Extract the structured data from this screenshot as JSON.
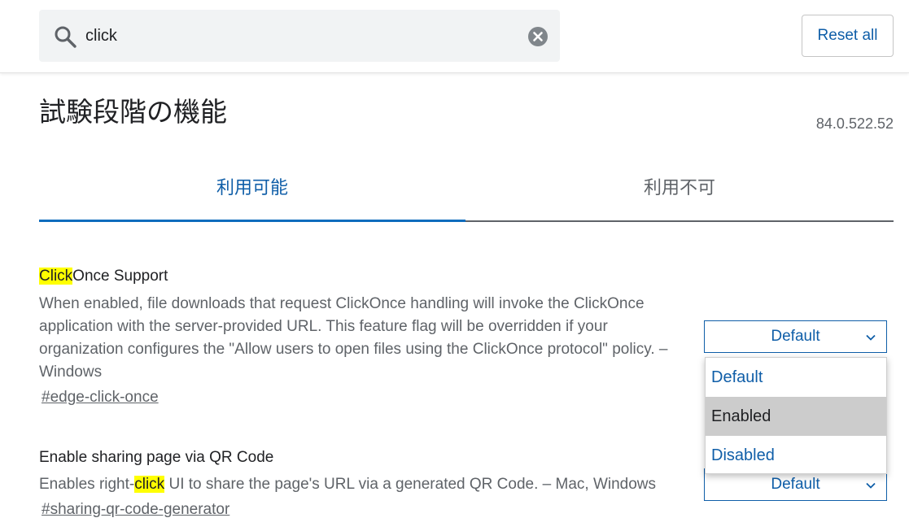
{
  "search": {
    "query": "click"
  },
  "header": {
    "reset_label": "Reset all"
  },
  "page": {
    "title": "試験段階の機能",
    "version": "84.0.522.52"
  },
  "tabs": [
    {
      "label": "利用可能",
      "active": true
    },
    {
      "label": "利用不可",
      "active": false
    }
  ],
  "flags": [
    {
      "title_highlight": "Click",
      "title_rest": "Once Support",
      "description": "When enabled, file downloads that request ClickOnce handling will invoke the ClickOnce application with the server-provided URL. This feature flag will be overridden if your organization configures the \"Allow users to open files using the ClickOnce protocol\" policy. – Windows",
      "link": "#edge-click-once",
      "select_value": "Default",
      "options": [
        "Default",
        "Enabled",
        "Disabled"
      ],
      "dropdown_open": true,
      "hovered_option": "Enabled"
    },
    {
      "title": "Enable sharing page via QR Code",
      "desc_before": "Enables right-",
      "desc_highlight": "click",
      "desc_after": " UI to share the page's URL via a generated QR Code. – Mac, Windows",
      "link": "#sharing-qr-code-generator",
      "select_value": "Default"
    }
  ],
  "colors": {
    "accent": "#0f5ea8",
    "highlight": "#ffff00",
    "text_secondary": "#5f6368"
  },
  "icons": [
    "search-icon",
    "clear-icon",
    "chevron-down-icon"
  ]
}
